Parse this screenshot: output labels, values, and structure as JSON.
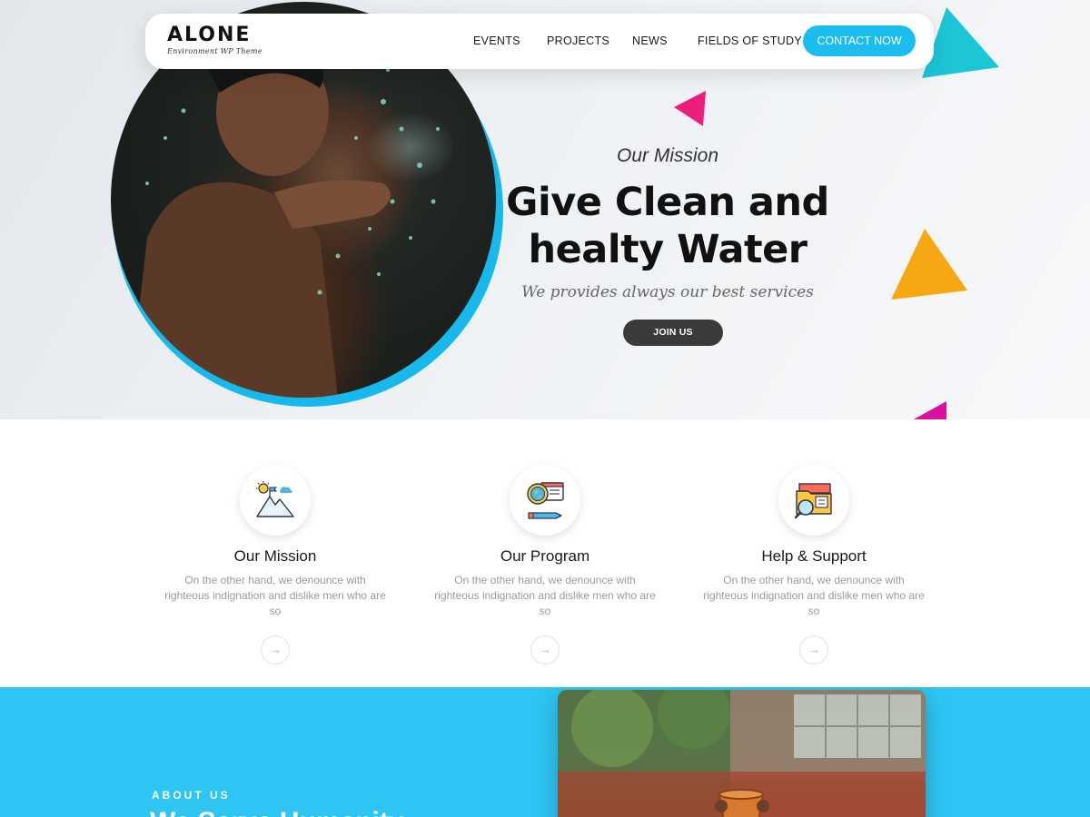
{
  "brand": {
    "name": "ALONE",
    "tagline": "Environment WP Theme"
  },
  "nav": {
    "items": [
      {
        "label": "EVENTS"
      },
      {
        "label": "PROJECTS"
      },
      {
        "label": "NEWS"
      },
      {
        "label": "FIELDS OF STUDY"
      }
    ],
    "cta_label": "CONTACT NOW"
  },
  "hero": {
    "kicker": "Our Mission",
    "title_line1": "Give Clean and",
    "title_line2": "healty Water",
    "subtitle": "We provides always our best services",
    "button_label": "JOIN US"
  },
  "features": [
    {
      "icon": "mountain-flag-icon",
      "title": "Our Mission",
      "desc": "On the other hand, we denounce with righteous indignation and dislike men who are so"
    },
    {
      "icon": "globe-chat-icon",
      "title": "Our Program",
      "desc": "On the other hand, we denounce with righteous indignation and dislike men who are so"
    },
    {
      "icon": "folder-search-icon",
      "title": "Help & Support",
      "desc": "On the other hand, we denounce with righteous indignation and dislike men who are so"
    }
  ],
  "about": {
    "kicker": "ABOUT US",
    "heading": "We Serve Humanity"
  },
  "colors": {
    "accent": "#1bbdf0",
    "about_bg": "#2ec5f2",
    "dark_button": "#3a3a3a"
  }
}
